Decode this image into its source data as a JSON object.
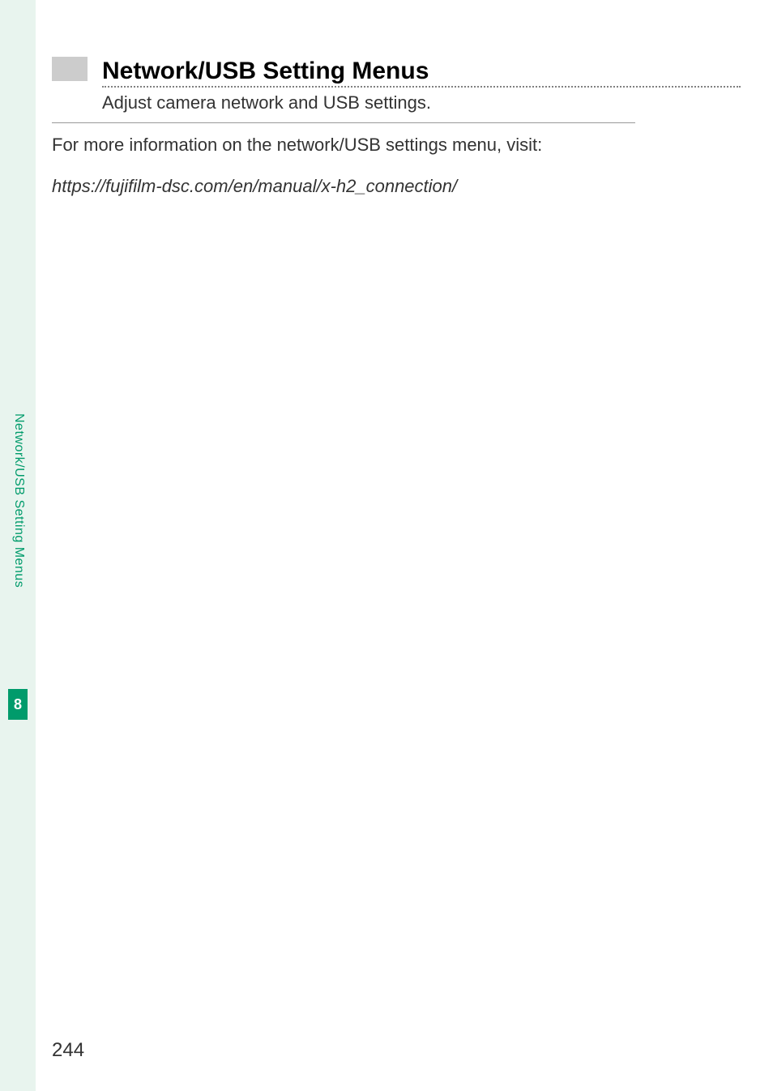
{
  "sidebar": {
    "tab_label": "Network/USB Setting Menus",
    "chapter_number": "8"
  },
  "heading": {
    "title": "Network/USB Setting Menus",
    "subtitle": "Adjust camera network and USB settings."
  },
  "body": {
    "intro": "For more information on the network/USB settings menu, visit:",
    "link": "https://fujifilm-dsc.com/en/manual/x-h2_connection/"
  },
  "page_number": "244"
}
